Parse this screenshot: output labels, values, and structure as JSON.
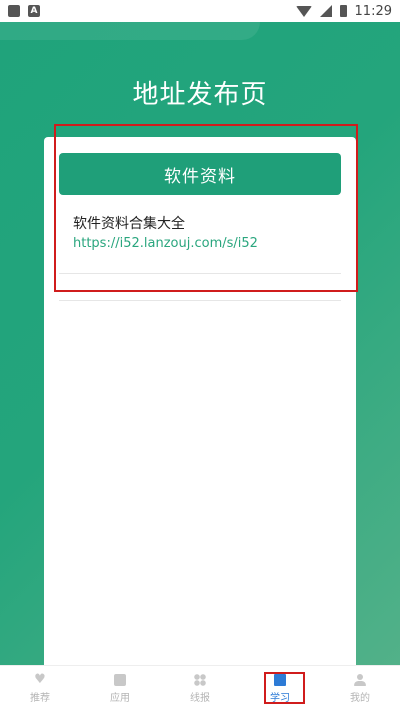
{
  "status_bar": {
    "time": "11:29",
    "left_icons": [
      "image-icon",
      "a-icon"
    ],
    "right_icons": [
      "wifi-icon",
      "signal-icon",
      "battery-icon"
    ]
  },
  "page": {
    "title": "地址发布页"
  },
  "section": {
    "button_label": "软件资料",
    "items": [
      {
        "title": "软件资料合集大全",
        "link": "https://i52.lanzouj.com/s/i52"
      }
    ]
  },
  "bottom_nav": {
    "items": [
      {
        "label": "推荐",
        "icon": "heart-icon",
        "active": false
      },
      {
        "label": "应用",
        "icon": "app-icon",
        "active": false
      },
      {
        "label": "线报",
        "icon": "grid-icon",
        "active": false
      },
      {
        "label": "学习",
        "icon": "book-icon",
        "active": true
      },
      {
        "label": "我的",
        "icon": "user-icon",
        "active": false
      }
    ]
  },
  "colors": {
    "primary_green": "#1f9f79",
    "link_green": "#2aa67e",
    "active_blue": "#2d7bd6",
    "highlight_red": "#d01c1c"
  }
}
